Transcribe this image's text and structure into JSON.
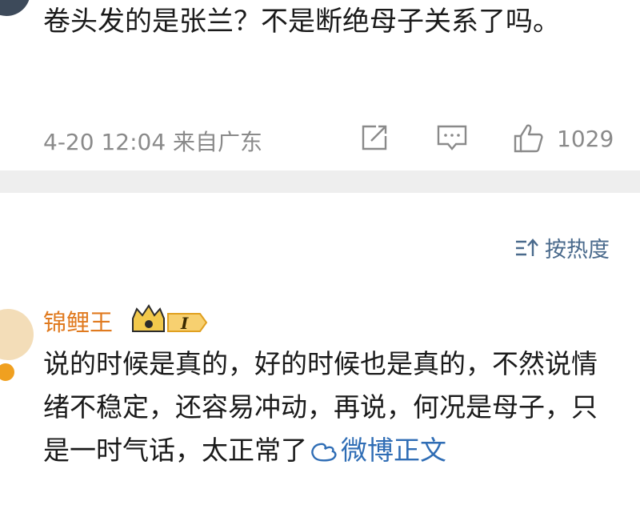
{
  "post": {
    "text": "卷头发的是张兰？不是断绝母子关系了吗。",
    "meta": "4-20 12:04 来自广东",
    "like_count": "1029",
    "icons": [
      "share-icon",
      "comment-icon",
      "like-icon"
    ]
  },
  "sort": {
    "label": "按热度",
    "icon": "sort-icon"
  },
  "comment": {
    "username": "锦鲤王",
    "badge_level": "I",
    "text": "说的时候是真的，好的时候也是真的，不然说情绪不稳定，还容易冲动，再说，何况是母子，只是一时气话，太正常了",
    "link_label": "微博正文",
    "colors": {
      "username": "#e07a1f",
      "link": "#2f6db5",
      "badge": "#f2b233"
    }
  }
}
